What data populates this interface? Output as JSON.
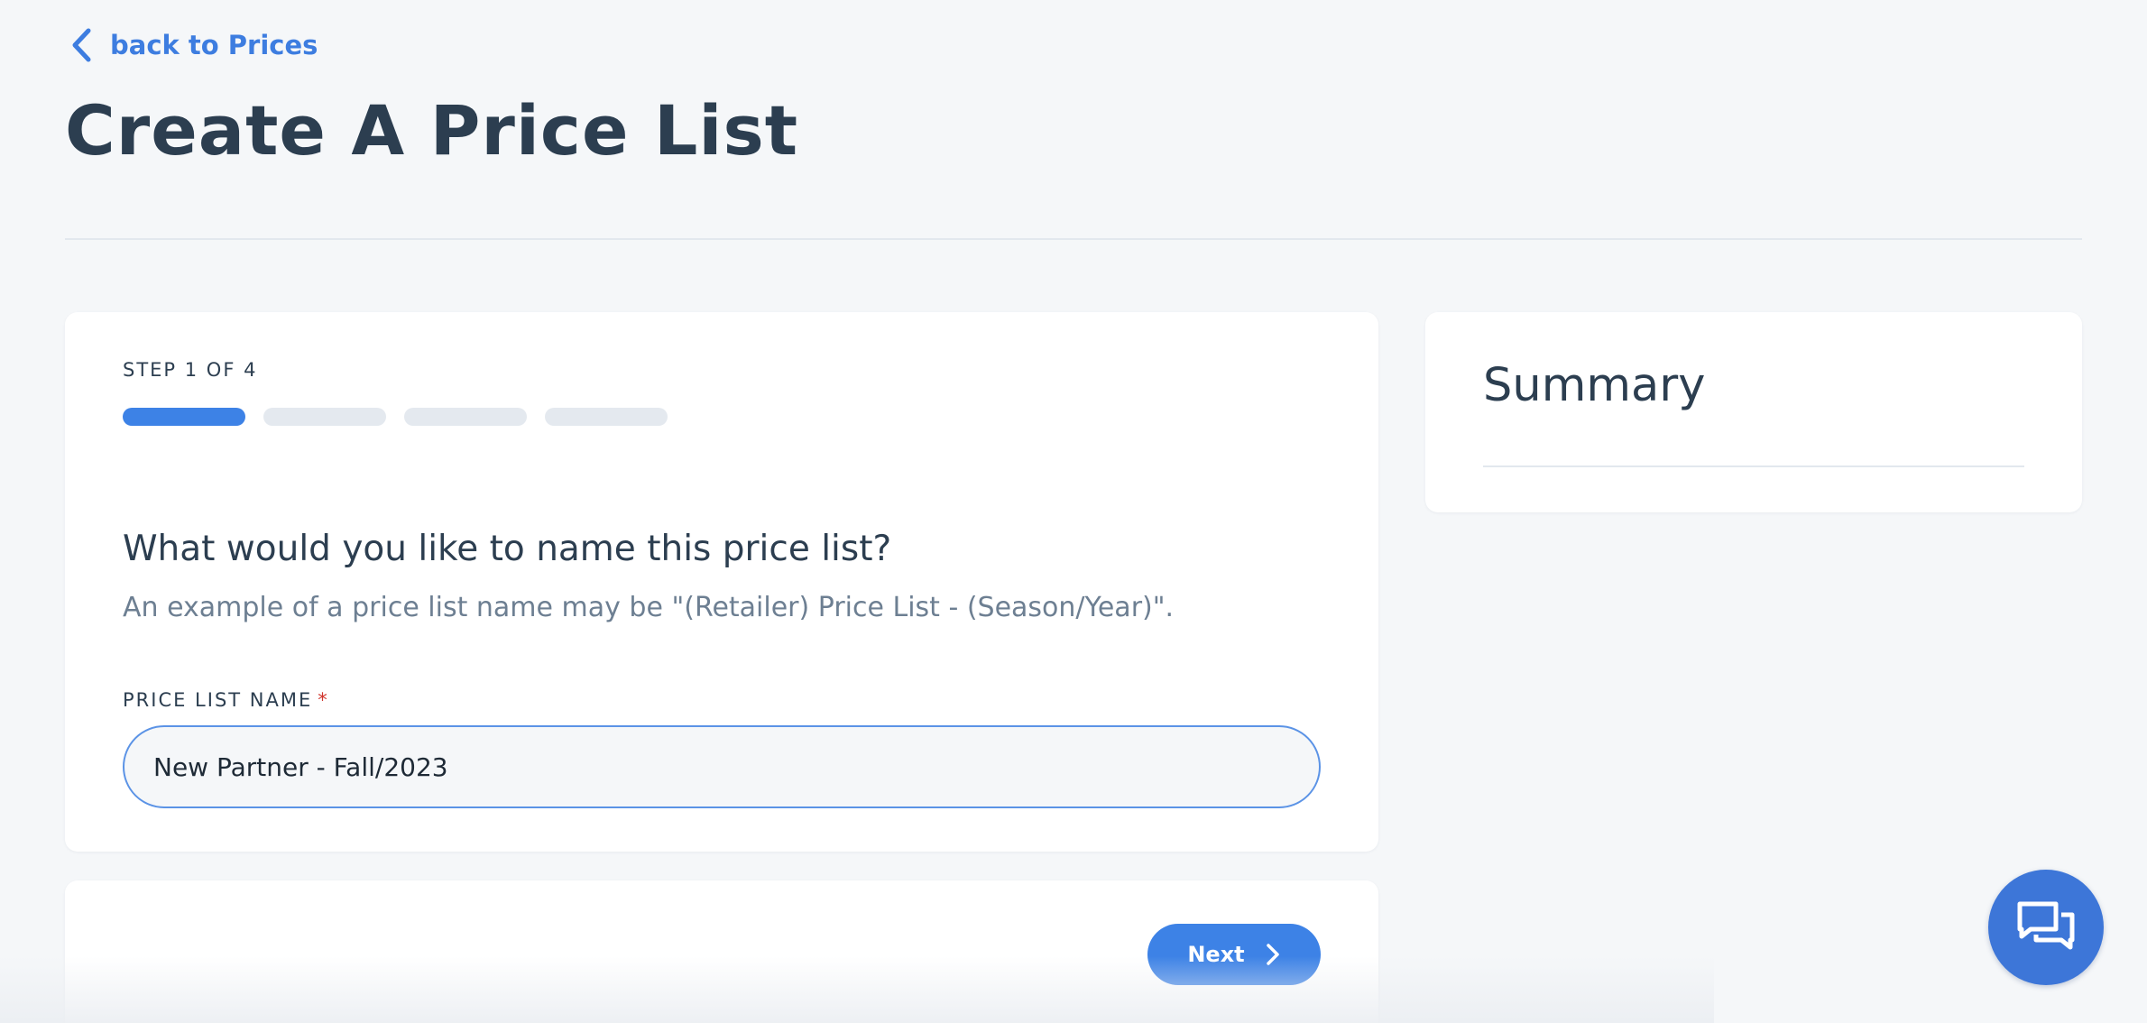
{
  "nav": {
    "back_label": "back to Prices"
  },
  "header": {
    "title": "Create A Price List"
  },
  "step": {
    "label": "STEP 1 OF 4",
    "current": 1,
    "total": 4
  },
  "form": {
    "question": "What would you like to name this price list?",
    "hint": "An example of a price list name may be \"(Retailer) Price List - (Season/Year)\".",
    "field_label": "PRICE LIST NAME",
    "required_marker": "*",
    "field_value": "New Partner - Fall/2023"
  },
  "footer": {
    "next_label": "Next"
  },
  "summary": {
    "title": "Summary"
  },
  "colors": {
    "accent": "#3d82e6",
    "title": "#2c3e50",
    "required": "#d0342c",
    "background": "#f5f7f9"
  },
  "icons": {
    "back": "chevron-left-icon",
    "next": "chevron-right-icon",
    "chat": "chat-bubbles-icon"
  }
}
